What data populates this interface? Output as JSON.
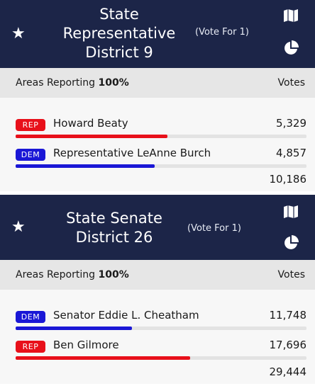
{
  "races": [
    {
      "title": "State Representative District 9",
      "title_lines": [
        "State",
        "Representative",
        "District 9"
      ],
      "vote_for": "(Vote For 1)",
      "reporting_label": "Areas Reporting",
      "reporting_value": "100%",
      "votes_header": "Votes",
      "candidates": [
        {
          "party": "REP",
          "name": "Howard Beaty",
          "votes": "5,329",
          "share": 0.523
        },
        {
          "party": "DEM",
          "name": "Representative LeAnne Burch",
          "votes": "4,857",
          "share": 0.477
        }
      ],
      "total": "10,186"
    },
    {
      "title": "State Senate District 26",
      "title_lines": [
        "State Senate",
        "District 26"
      ],
      "vote_for": "(Vote For 1)",
      "reporting_label": "Areas Reporting",
      "reporting_value": "100%",
      "votes_header": "Votes",
      "candidates": [
        {
          "party": "DEM",
          "name": "Senator Eddie L. Cheatham",
          "votes": "11,748",
          "share": 0.399
        },
        {
          "party": "REP",
          "name": "Ben Gilmore",
          "votes": "17,696",
          "share": 0.601
        }
      ],
      "total": "29,444"
    }
  ],
  "icons": {
    "favorite": "star-icon",
    "map": "map-icon",
    "chart": "pie-chart-icon"
  },
  "colors": {
    "header_bg": "#1c2548",
    "rep": "#e8101a",
    "dem": "#1a17d6",
    "report_bg": "#e6e6e6"
  }
}
